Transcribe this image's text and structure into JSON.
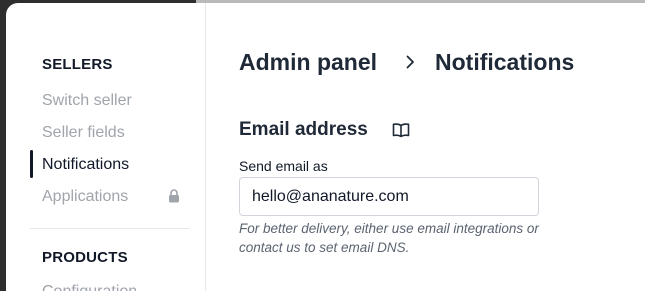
{
  "sidebar": {
    "sellers_title": "SELLERS",
    "sellers_items": [
      {
        "label": "Switch seller"
      },
      {
        "label": "Seller fields"
      },
      {
        "label": "Notifications"
      },
      {
        "label": "Applications",
        "icon": "lock-icon"
      }
    ],
    "products_title": "PRODUCTS",
    "products_items": [
      {
        "label": "Configuration"
      }
    ]
  },
  "breadcrumb": {
    "parent": "Admin panel",
    "current": "Notifications",
    "separator_icon": "chevron-right-icon"
  },
  "email_section": {
    "heading": "Email address",
    "heading_icon": "book-icon",
    "field_label": "Send email as",
    "field_value": "hello@ananature.com",
    "help_text": "For better delivery, either use email integrations or contact us to set email DNS."
  },
  "colors": {
    "text_primary": "#111827",
    "text_muted": "#a0a4ab",
    "help_text": "#5b6370",
    "border": "#d1d5db",
    "backdrop": "#2e2e2e"
  }
}
